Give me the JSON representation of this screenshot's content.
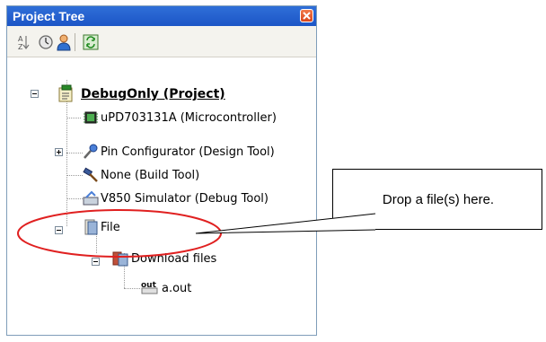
{
  "panel": {
    "title": "Project Tree"
  },
  "toolbar": {
    "buttons": [
      "sort-icon",
      "property-icon",
      "member-icon",
      "refresh-icon"
    ]
  },
  "tree": {
    "project": "DebugOnly (Project)",
    "microcontroller": "uPD703131A (Microcontroller)",
    "pin_configurator": "Pin Configurator (Design Tool)",
    "build_tool": "None (Build Tool)",
    "debug_tool": "V850 Simulator (Debug Tool)",
    "file": "File",
    "download_files": "Download files",
    "a_out": "a.out"
  },
  "callout": {
    "text": "Drop a file(s) here."
  },
  "colors": {
    "title_bar": "#1c55c6",
    "highlight_ellipse": "#e02020"
  }
}
